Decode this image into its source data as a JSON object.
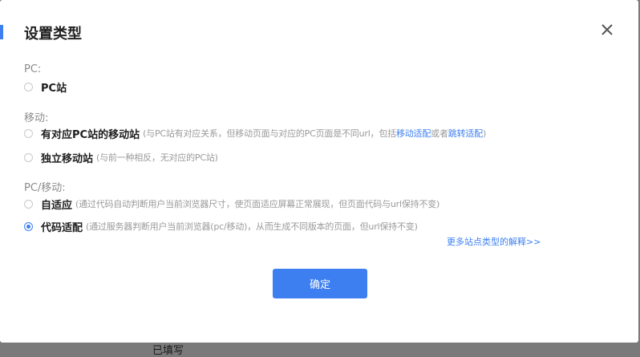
{
  "background": {
    "partial_text": "已填写"
  },
  "dialog": {
    "title": "设置类型",
    "close_icon": "close-icon",
    "groups": [
      {
        "label": "PC:"
      },
      {
        "label": "移动:"
      },
      {
        "label": "PC/移动:"
      }
    ],
    "options": [
      {
        "label": "PC站",
        "desc": "",
        "checked": false
      },
      {
        "label": "有对应PC站的移动站",
        "desc_prefix": "(与PC站有对应关系，但移动页面与对应的PC页面是不同url，包括",
        "link1": "移动适配",
        "desc_mid": "或者",
        "link2": "跳转适配",
        "desc_suffix": ")",
        "checked": false
      },
      {
        "label": "独立移动站",
        "desc": "(与前一种相反，无对应的PC站)",
        "checked": false
      },
      {
        "label": "自适应",
        "desc": "(通过代码自动判断用户当前浏览器尺寸，使页面适应屏幕正常展现，但页面代码与url保持不变)",
        "checked": false
      },
      {
        "label": "代码适配",
        "desc": "(通过服务器判断用户当前浏览器(pc/移动)，从而生成不同版本的页面，但url保持不变)",
        "checked": true
      }
    ],
    "more_link": "更多站点类型的解释>>",
    "confirm_label": "确定"
  },
  "colors": {
    "accent": "#3d7ff0",
    "overlay": "#7a7a7a"
  }
}
